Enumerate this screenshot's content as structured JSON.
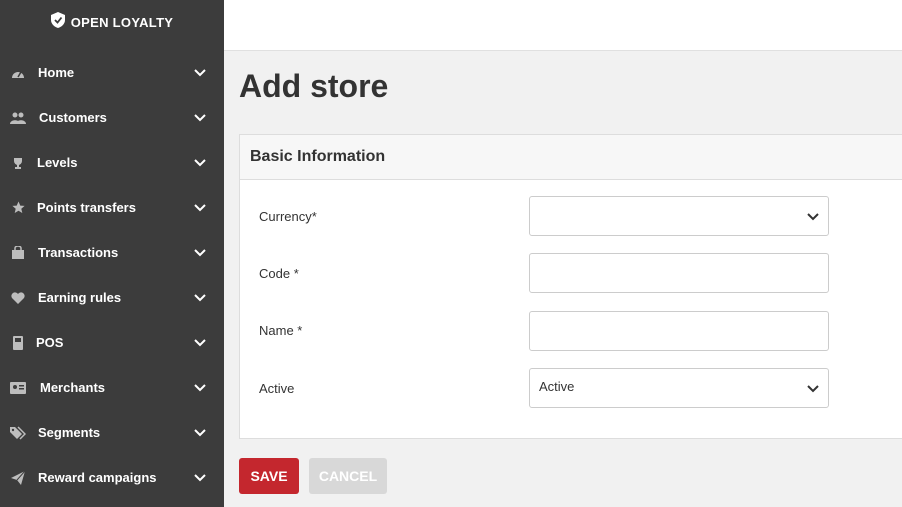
{
  "brand": {
    "name": "OPEN LOYALTY"
  },
  "sidebar": {
    "items": [
      {
        "label": "Home",
        "icon": "dashboard-icon"
      },
      {
        "label": "Customers",
        "icon": "users-icon"
      },
      {
        "label": "Levels",
        "icon": "trophy-icon"
      },
      {
        "label": "Points transfers",
        "icon": "star-icon"
      },
      {
        "label": "Transactions",
        "icon": "shopping-bag-icon"
      },
      {
        "label": "Earning rules",
        "icon": "heart-icon"
      },
      {
        "label": "POS",
        "icon": "pos-terminal-icon"
      },
      {
        "label": "Merchants",
        "icon": "id-card-icon"
      },
      {
        "label": "Segments",
        "icon": "tags-icon"
      },
      {
        "label": "Reward campaigns",
        "icon": "paper-plane-icon"
      }
    ]
  },
  "page": {
    "title": "Add store"
  },
  "form": {
    "section_title": "Basic Information",
    "currency": {
      "label": "Currency*",
      "value": ""
    },
    "code": {
      "label": "Code *",
      "value": ""
    },
    "name": {
      "label": "Name *",
      "value": ""
    },
    "active": {
      "label": "Active",
      "value": "Active"
    }
  },
  "actions": {
    "save_label": "SAVE",
    "cancel_label": "CANCEL"
  },
  "colors": {
    "sidebar_bg": "#3c3c3c",
    "save_bg": "#c4272e",
    "cancel_bg": "#d8d8d8"
  }
}
